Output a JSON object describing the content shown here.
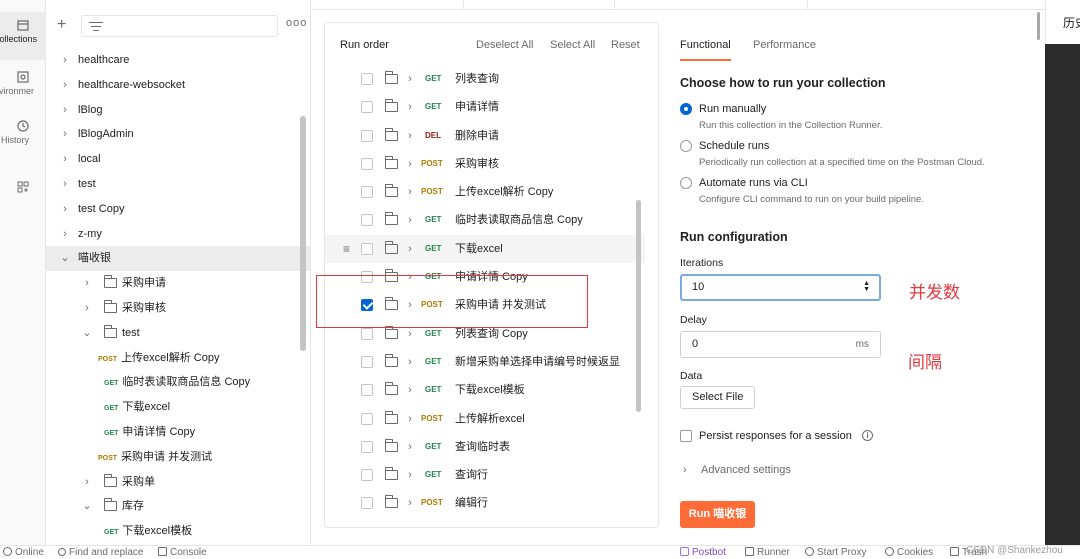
{
  "rail": {
    "items": [
      {
        "label": "Collections"
      },
      {
        "label": "Environments"
      },
      {
        "label": "History"
      },
      {
        "label": ""
      }
    ]
  },
  "sidebar": {
    "more": "ooo",
    "tree": [
      {
        "depth": 0,
        "chev": "›",
        "label": "healthcare"
      },
      {
        "depth": 0,
        "chev": "›",
        "label": "healthcare-websocket"
      },
      {
        "depth": 0,
        "chev": "›",
        "label": "lBlog"
      },
      {
        "depth": 0,
        "chev": "›",
        "label": "lBlogAdmin"
      },
      {
        "depth": 0,
        "chev": "›",
        "label": "local"
      },
      {
        "depth": 0,
        "chev": "›",
        "label": "test"
      },
      {
        "depth": 0,
        "chev": "›",
        "label": "test Copy"
      },
      {
        "depth": 0,
        "chev": "›",
        "label": "z-my"
      },
      {
        "depth": 0,
        "chev": "⌄",
        "label": "喵收银",
        "selected": true
      },
      {
        "depth": 1,
        "chev": "›",
        "folder": true,
        "label": "采购申请"
      },
      {
        "depth": 1,
        "chev": "›",
        "folder": true,
        "label": "采购审核"
      },
      {
        "depth": 1,
        "chev": "⌄",
        "folder": true,
        "label": "test"
      },
      {
        "depth": 2,
        "method": "POST",
        "label": "上传excel解析 Copy"
      },
      {
        "depth": 2,
        "method": "GET",
        "label": "临时表读取商品信息 Copy"
      },
      {
        "depth": 2,
        "method": "GET",
        "label": "下载excel"
      },
      {
        "depth": 2,
        "method": "GET",
        "label": "申请详情 Copy"
      },
      {
        "depth": 2,
        "method": "POST",
        "label": "采购申请 并发测试"
      },
      {
        "depth": 1,
        "chev": "›",
        "folder": true,
        "label": "采购单"
      },
      {
        "depth": 1,
        "chev": "⌄",
        "folder": true,
        "label": "库存"
      },
      {
        "depth": 2,
        "method": "GET",
        "label": "下载excel模板"
      }
    ]
  },
  "run_order": {
    "title": "Run order",
    "deselect_all": "Deselect All",
    "select_all": "Select All",
    "reset": "Reset",
    "items": [
      {
        "method": "GET",
        "name": "列表查询",
        "checked": false
      },
      {
        "method": "GET",
        "name": "申请详情",
        "checked": false
      },
      {
        "method": "DEL",
        "name": "删除申请",
        "checked": false
      },
      {
        "method": "POST",
        "name": "采购审核",
        "checked": false
      },
      {
        "method": "POST",
        "name": "上传excel解析 Copy",
        "checked": false
      },
      {
        "method": "GET",
        "name": "临时表读取商品信息 Copy",
        "checked": false
      },
      {
        "method": "GET",
        "name": "下载excel",
        "checked": false,
        "drag": true
      },
      {
        "method": "GET",
        "name": "申请详情 Copy",
        "checked": false
      },
      {
        "method": "POST",
        "name": "采购申请 并发测试",
        "checked": true
      },
      {
        "method": "GET",
        "name": "列表查询 Copy",
        "checked": false
      },
      {
        "method": "GET",
        "name": "新增采购单选择申请编号时候返显",
        "checked": false
      },
      {
        "method": "GET",
        "name": "下载excel模板",
        "checked": false
      },
      {
        "method": "POST",
        "name": "上传解析excel",
        "checked": false
      },
      {
        "method": "GET",
        "name": "查询临时表",
        "checked": false
      },
      {
        "method": "GET",
        "name": "查询行",
        "checked": false
      },
      {
        "method": "POST",
        "name": "编辑行",
        "checked": false
      }
    ]
  },
  "config": {
    "tabs": [
      "Functional",
      "Performance"
    ],
    "choose_title": "Choose how to run your collection",
    "options": [
      {
        "label": "Run manually",
        "desc": "Run this collection in the Collection Runner.",
        "selected": true
      },
      {
        "label": "Schedule runs",
        "desc": "Periodically run collection at a specified time on the Postman Cloud.",
        "selected": false
      },
      {
        "label": "Automate runs via CLI",
        "desc": "Configure CLI command to run on your build pipeline.",
        "selected": false
      }
    ],
    "run_config_title": "Run configuration",
    "iterations_label": "Iterations",
    "iterations_value": "10",
    "delay_label": "Delay",
    "delay_value": "0",
    "delay_unit": "ms",
    "data_label": "Data",
    "select_file": "Select File",
    "persist_label": "Persist responses for a session",
    "advanced": "Advanced settings",
    "run_button": "Run 喵收银"
  },
  "annotations": {
    "concurrency": "并发数",
    "interval": "间隔"
  },
  "far_right": {
    "text": "历史"
  },
  "status": {
    "online": "Online",
    "find": "Find and replace",
    "console": "Console",
    "postbot": "Postbot",
    "runner": "Runner",
    "proxy": "Start Proxy",
    "cookies": "Cookies",
    "trash": "Trash",
    "watermark": "CSDN @Shankezhou"
  },
  "colors": {
    "accent": "#ff6c37",
    "get": "#1f8a4c",
    "post": "#ad7a03",
    "del": "#8e1a10",
    "checkbox": "#0265d2",
    "annotation": "#e0383e"
  }
}
